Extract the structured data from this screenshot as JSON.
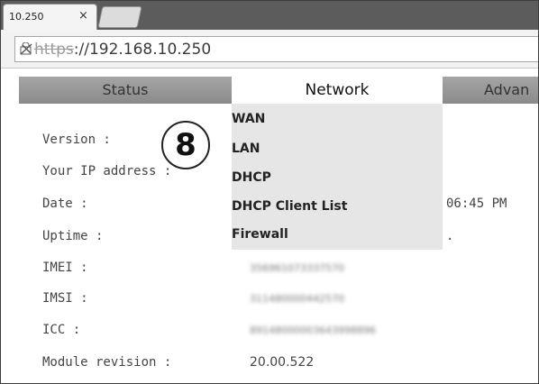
{
  "browser": {
    "tab_title": "10.250",
    "tab_close": "×",
    "url_scheme": "https",
    "url_rest": "://192.168.10.250"
  },
  "nav": {
    "status": "Status",
    "network": "Network",
    "advanced": "Advan"
  },
  "network_menu": [
    "WAN",
    "LAN",
    "DHCP",
    "DHCP Client List",
    "Firewall"
  ],
  "badge": "8",
  "info": {
    "version_label": "Version :",
    "ip_label": "Your IP address :",
    "date_label": "Date :",
    "date_value_partial": "06:45 PM",
    "uptime_label": "Uptime :",
    "uptime_value_partial": ".",
    "imei_label": "IMEI :",
    "imei_value": "356961073337570",
    "imsi_label": "IMSI :",
    "imsi_value": "311480000442570",
    "icc_label": "ICC :",
    "icc_value": "89148000003643998896",
    "module_label": "Module revision :",
    "module_value": "20.00.522"
  }
}
